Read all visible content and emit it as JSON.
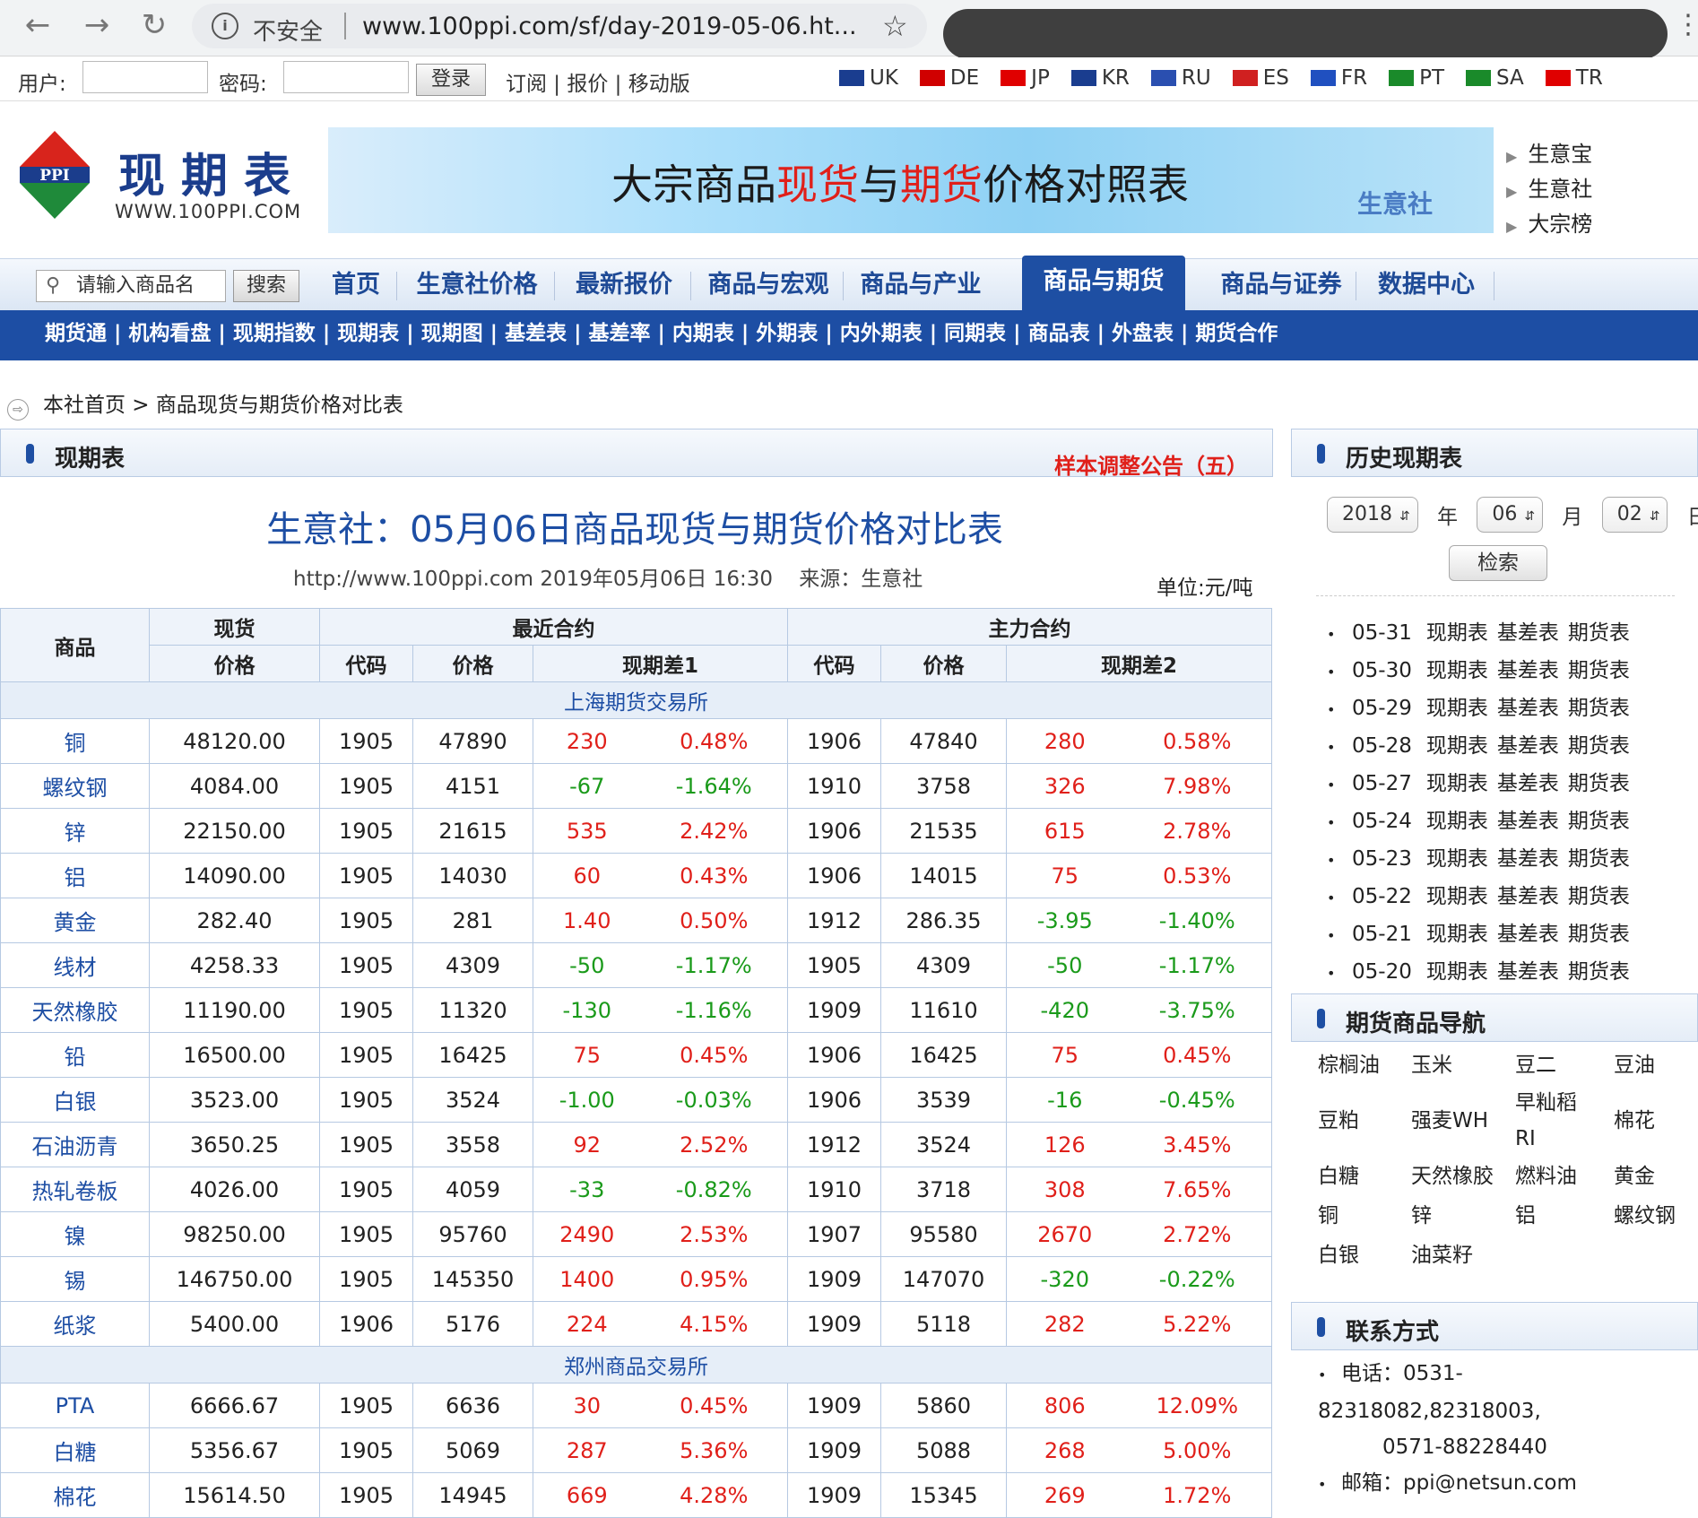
{
  "browser": {
    "insecure": "不安全",
    "url": "www.100ppi.com/sf/day-2019-05-06.ht..."
  },
  "login": {
    "user_label": "用户:",
    "pass_label": "密码:",
    "login_button": "登录",
    "links": "订阅 | 报价 | 移动版",
    "languages": [
      {
        "code": "UK",
        "color": "#1a3d8f"
      },
      {
        "code": "DE",
        "color": "#d00000"
      },
      {
        "code": "JP",
        "color": "#e00000"
      },
      {
        "code": "KR",
        "color": "#1a3d8f"
      },
      {
        "code": "RU",
        "color": "#2a4fb0"
      },
      {
        "code": "ES",
        "color": "#d02020"
      },
      {
        "code": "FR",
        "color": "#2050c0"
      },
      {
        "code": "PT",
        "color": "#1a8a2a"
      },
      {
        "code": "SA",
        "color": "#1a8a2a"
      },
      {
        "code": "TR",
        "color": "#e00000"
      }
    ]
  },
  "header": {
    "logo_mark": "PPI",
    "logo_cn": "现期表",
    "logo_en": "WWW.100PPI.COM",
    "banner_part1": "大宗商品",
    "banner_part2": "现货",
    "banner_part3": "与",
    "banner_part4": "期货",
    "banner_part5": "价格对照表",
    "banner_brand": "生意社",
    "side_links": [
      "生意宝",
      "生意社",
      "大宗榜"
    ]
  },
  "nav": {
    "search_placeholder": "请输入商品名",
    "search_button": "搜索",
    "items": [
      "首页",
      "生意社价格",
      "最新报价",
      "商品与宏观",
      "商品与产业",
      "商品与期货",
      "商品与证券",
      "数据中心"
    ],
    "sub": "期货通 | 机构看盘 | 现期指数 | 现期表 | 现期图 | 基差表 | 基差率 | 内期表 | 外期表 | 内外期表 | 同期表 | 商品表 | 外盘表 | 期货合作"
  },
  "breadcrumb": "本社首页 > 商品现货与期货价格对比表",
  "main": {
    "panel_title": "现期表",
    "notice": "样本调整公告（五）",
    "title": "生意社：05月06日商品现货与期货价格对比表",
    "info_site": "http://www.100ppi.com",
    "info_time": "2019年05月06日 16:30",
    "info_source": "来源：生意社",
    "unit": "单位:元/吨",
    "headers": {
      "commodity": "商品",
      "spot": "现货",
      "recent": "最近合约",
      "main": "主力合约",
      "price": "价格",
      "code": "代码",
      "diff1": "现期差1",
      "diff2": "现期差2"
    },
    "exchanges": [
      "上海期货交易所",
      "郑州商品交易所"
    ],
    "rows_sh": [
      [
        "铜",
        "48120.00",
        "1905",
        "47890",
        "230",
        "0.48%",
        "1906",
        "47840",
        "280",
        "0.58%"
      ],
      [
        "螺纹钢",
        "4084.00",
        "1905",
        "4151",
        "-67",
        "-1.64%",
        "1910",
        "3758",
        "326",
        "7.98%"
      ],
      [
        "锌",
        "22150.00",
        "1905",
        "21615",
        "535",
        "2.42%",
        "1906",
        "21535",
        "615",
        "2.78%"
      ],
      [
        "铝",
        "14090.00",
        "1905",
        "14030",
        "60",
        "0.43%",
        "1906",
        "14015",
        "75",
        "0.53%"
      ],
      [
        "黄金",
        "282.40",
        "1905",
        "281",
        "1.40",
        "0.50%",
        "1912",
        "286.35",
        "-3.95",
        "-1.40%"
      ],
      [
        "线材",
        "4258.33",
        "1905",
        "4309",
        "-50",
        "-1.17%",
        "1905",
        "4309",
        "-50",
        "-1.17%"
      ],
      [
        "天然橡胶",
        "11190.00",
        "1905",
        "11320",
        "-130",
        "-1.16%",
        "1909",
        "11610",
        "-420",
        "-3.75%"
      ],
      [
        "铅",
        "16500.00",
        "1905",
        "16425",
        "75",
        "0.45%",
        "1906",
        "16425",
        "75",
        "0.45%"
      ],
      [
        "白银",
        "3523.00",
        "1905",
        "3524",
        "-1.00",
        "-0.03%",
        "1906",
        "3539",
        "-16",
        "-0.45%"
      ],
      [
        "石油沥青",
        "3650.25",
        "1905",
        "3558",
        "92",
        "2.52%",
        "1912",
        "3524",
        "126",
        "3.45%"
      ],
      [
        "热轧卷板",
        "4026.00",
        "1905",
        "4059",
        "-33",
        "-0.82%",
        "1910",
        "3718",
        "308",
        "7.65%"
      ],
      [
        "镍",
        "98250.00",
        "1905",
        "95760",
        "2490",
        "2.53%",
        "1907",
        "95580",
        "2670",
        "2.72%"
      ],
      [
        "锡",
        "146750.00",
        "1905",
        "145350",
        "1400",
        "0.95%",
        "1909",
        "147070",
        "-320",
        "-0.22%"
      ],
      [
        "纸浆",
        "5400.00",
        "1906",
        "5176",
        "224",
        "4.15%",
        "1909",
        "5118",
        "282",
        "5.22%"
      ]
    ],
    "rows_zz": [
      [
        "PTA",
        "6666.67",
        "1905",
        "6636",
        "30",
        "0.45%",
        "1909",
        "5860",
        "806",
        "12.09%"
      ],
      [
        "白糖",
        "5356.67",
        "1905",
        "5069",
        "287",
        "5.36%",
        "1909",
        "5088",
        "268",
        "5.00%"
      ],
      [
        "棉花",
        "15614.50",
        "1905",
        "14945",
        "669",
        "4.28%",
        "1909",
        "15345",
        "269",
        "1.72%"
      ]
    ]
  },
  "history": {
    "title": "历史现期表",
    "year": "2018",
    "month": "06",
    "day": "02",
    "year_unit": "年",
    "month_unit": "月",
    "day_unit": "日",
    "search_button": "检索",
    "dates": [
      "05-31",
      "05-30",
      "05-29",
      "05-28",
      "05-27",
      "05-24",
      "05-23",
      "05-22",
      "05-21",
      "05-20"
    ],
    "link1": "现期表",
    "link2": "基差表",
    "link3": "期货表"
  },
  "futures_nav": {
    "title": "期货商品导航",
    "items": [
      "棕榈油",
      "玉米",
      "豆二",
      "豆油",
      "豆粕",
      "强麦WH",
      "早籼稻RI",
      "棉花",
      "白糖",
      "天然橡胶",
      "燃料油",
      "黄金",
      "铜",
      "锌",
      "铝",
      "螺纹钢",
      "白银",
      "油菜籽"
    ]
  },
  "contact": {
    "title": "联系方式",
    "phone_label": "电话：",
    "phone1": "0531-",
    "phone2": "82318082,82318003,",
    "phone3": "0571-88228440",
    "email_label": "邮箱：",
    "email": "ppi@netsun.com"
  }
}
